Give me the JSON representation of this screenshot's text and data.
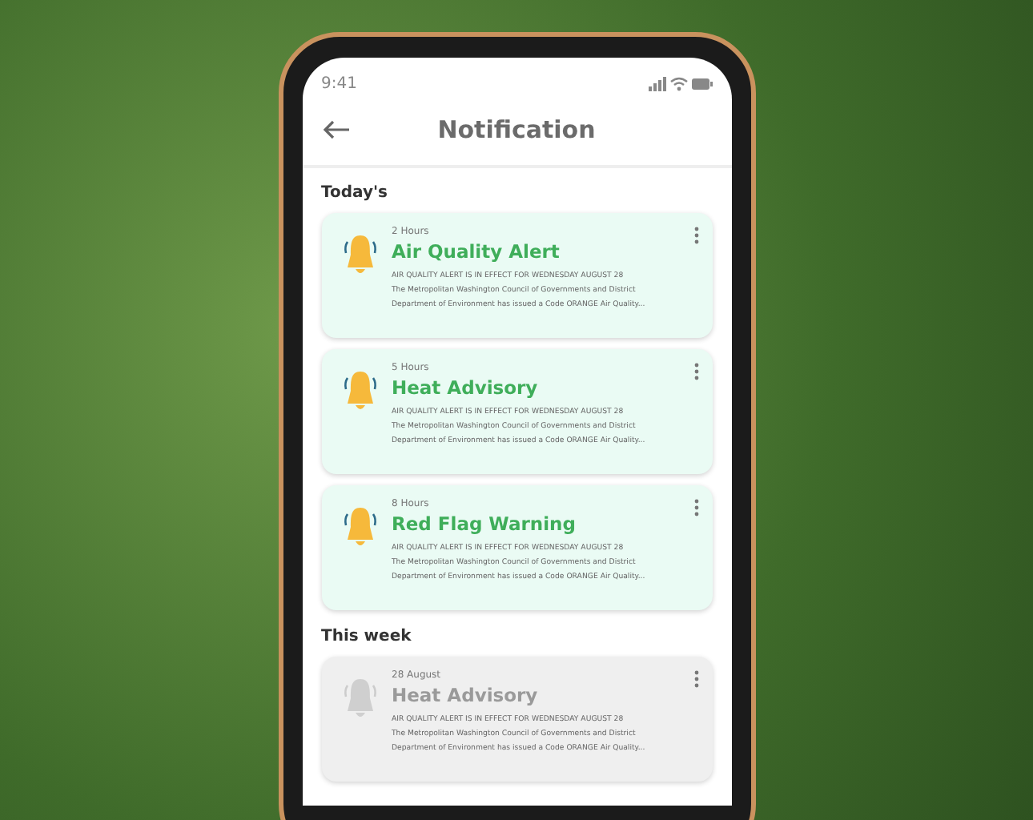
{
  "status_bar": {
    "time": "9:41"
  },
  "header": {
    "title": "Notification"
  },
  "sections": [
    {
      "title": "Today's",
      "notifications": [
        {
          "time": "2 Hours",
          "title": "Air Quality Alert",
          "read": false,
          "lines": [
            "AIR QUALITY ALERT IS IN EFFECT FOR WEDNESDAY AUGUST 28",
            "The Metropolitan Washington Council of Governments and District",
            "Department of Environment has issued a Code ORANGE Air Quality..."
          ]
        },
        {
          "time": "5 Hours",
          "title": "Heat Advisory",
          "read": false,
          "lines": [
            "AIR QUALITY ALERT IS IN EFFECT FOR WEDNESDAY AUGUST 28",
            "The Metropolitan Washington Council of Governments and District",
            "Department of Environment has issued a Code ORANGE Air Quality..."
          ]
        },
        {
          "time": "8 Hours",
          "title": "Red Flag Warning",
          "read": false,
          "lines": [
            "AIR QUALITY ALERT IS IN EFFECT FOR WEDNESDAY AUGUST 28",
            "The Metropolitan Washington Council of Governments and District",
            "Department of Environment has issued a Code ORANGE Air Quality..."
          ]
        }
      ]
    },
    {
      "title": "This week",
      "notifications": [
        {
          "time": "28 August",
          "title": "Heat Advisory",
          "read": true,
          "lines": [
            "AIR QUALITY ALERT IS IN EFFECT FOR WEDNESDAY AUGUST 28",
            "The Metropolitan Washington Council of Governments and District",
            "Department of Environment has issued a Code ORANGE Air Quality..."
          ]
        }
      ]
    }
  ]
}
